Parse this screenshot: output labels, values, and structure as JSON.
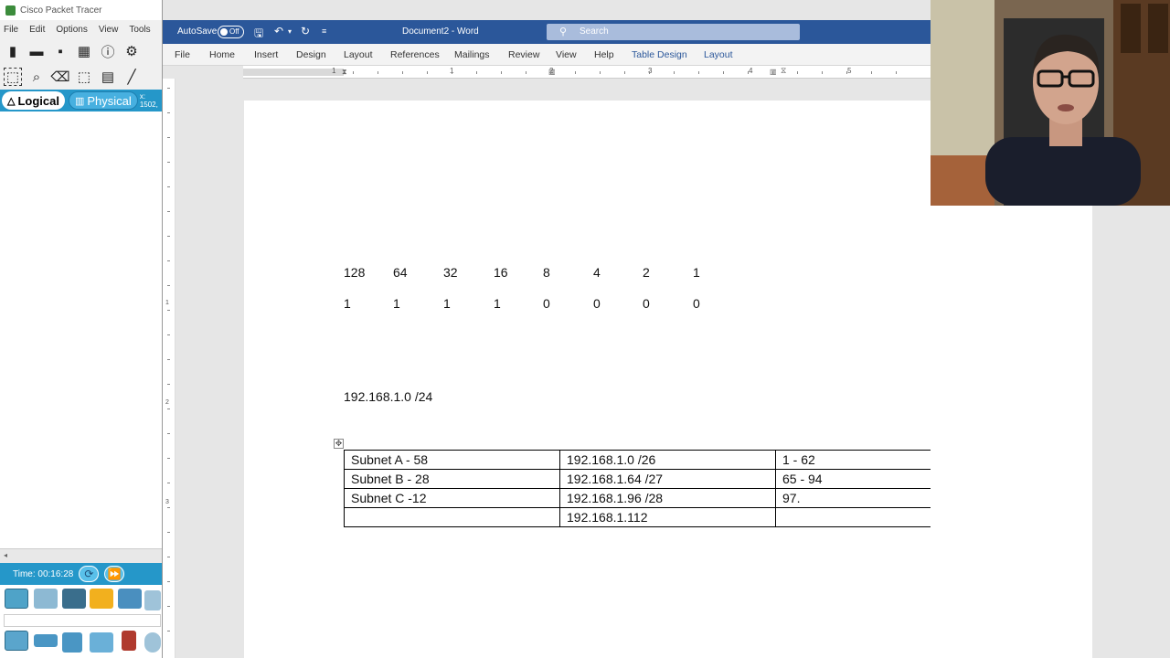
{
  "packet_tracer": {
    "title": "Cisco Packet Tracer",
    "menu": [
      "File",
      "Edit",
      "Options",
      "View",
      "Tools"
    ],
    "tabs": {
      "logical": "Logical",
      "physical": "Physical",
      "coord": "x: 1502,"
    },
    "time_label": "Time: 00:16:28"
  },
  "word": {
    "autosave_label": "AutoSave",
    "autosave_state": "Off",
    "document_title": "Document2 - Word",
    "search_placeholder": "Search",
    "ribbon_tabs": [
      "File",
      "Home",
      "Insert",
      "Design",
      "Layout",
      "References",
      "Mailings",
      "Review",
      "View",
      "Help",
      "Table Design",
      "Layout"
    ],
    "ruler_numbers": [
      "1",
      "1",
      "2",
      "3",
      "4",
      "5"
    ],
    "vruler_numbers": [
      "1",
      "2",
      "3"
    ]
  },
  "document": {
    "bit_values": [
      "128",
      "64",
      "32",
      "16",
      "8",
      "4",
      "2",
      "1"
    ],
    "mask_bits": [
      "1",
      "1",
      "1",
      "1",
      "0",
      "0",
      "0",
      "0"
    ],
    "network": "192.168.1.0 /24",
    "table_rows": [
      [
        "Subnet A - 58",
        "192.168.1.0 /26",
        "1 - 62"
      ],
      [
        "Subnet B - 28",
        "192.168.1.64 /27",
        "65 - 94"
      ],
      [
        "Subnet C -12",
        "192.168.1.96 /28",
        "97."
      ],
      [
        "",
        "192.168.1.112",
        ""
      ]
    ]
  },
  "colors": {
    "word_blue": "#2b579a",
    "pt_blue": "#2597c9"
  }
}
